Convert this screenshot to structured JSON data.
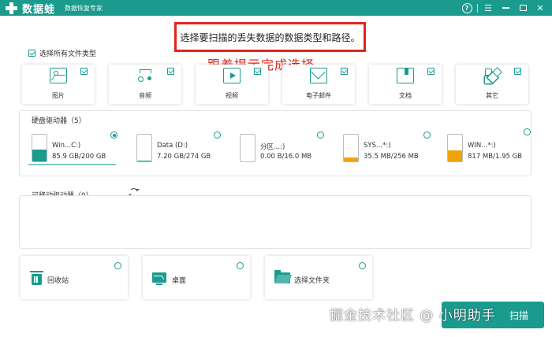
{
  "app": {
    "brand": "数据蛙",
    "tagline": "数据恢复专家",
    "help_icon": "question-circle-icon",
    "menu_icon": "hamburger-menu-icon",
    "minimize_icon": "minimize-icon",
    "maximize_icon": "maximize-icon",
    "close_icon": "close-icon",
    "accent_color": "#1a9b8e"
  },
  "annotation": {
    "instruction": "选择要扫描的丢失数据的数据类型和路径。",
    "hint": "跟着提示完成选择",
    "highlight_color": "#e0241f"
  },
  "file_types": {
    "select_all_label": "选择所有文件类型",
    "select_all_checked": true,
    "items": [
      {
        "label": "图片",
        "icon": "image-icon",
        "checked": true
      },
      {
        "label": "音频",
        "icon": "music-icon",
        "checked": true
      },
      {
        "label": "视频",
        "icon": "video-icon",
        "checked": true
      },
      {
        "label": "电子邮件",
        "icon": "mail-icon",
        "checked": true
      },
      {
        "label": "文档",
        "icon": "document-icon",
        "checked": true
      },
      {
        "label": "其它",
        "icon": "other-files-icon",
        "checked": true
      }
    ]
  },
  "hard_drives": {
    "title": "硬盘驱动器（5）",
    "items": [
      {
        "name": "Win...C:)",
        "size": "85.9 GB/200 GB",
        "used_fraction": 0.43,
        "fill_color": "#1a9b8e",
        "selected": true
      },
      {
        "name": "Data (D:)",
        "size": "7.20 GB/274 GB",
        "used_fraction": 0.03,
        "fill_color": "#1a9b8e",
        "selected": false
      },
      {
        "name": "分区...:)",
        "size": "0.00  B/16.0 MB",
        "used_fraction": 0.0,
        "fill_color": "#1a9b8e",
        "selected": false
      },
      {
        "name": "SYS...*:)",
        "size": "35.5 MB/256 MB",
        "used_fraction": 0.14,
        "fill_color": "#f0a30a",
        "selected": false
      },
      {
        "name": "WIN...*:)",
        "size": "817 MB/1.95 GB",
        "used_fraction": 0.42,
        "fill_color": "#f0a30a",
        "selected": false
      }
    ]
  },
  "removable": {
    "title": "可移动驱动器（0）",
    "refresh_icon": "refresh-icon"
  },
  "locations": [
    {
      "label": "回收站",
      "icon": "recycle-bin-icon",
      "selected": false
    },
    {
      "label": "桌面",
      "icon": "desktop-icon",
      "selected": false
    },
    {
      "label": "选择文件夹",
      "icon": "folder-icon",
      "selected": false
    }
  ],
  "scan_button": {
    "label": "扫描"
  },
  "watermark": "掘金技术社区 @ 小明助手"
}
